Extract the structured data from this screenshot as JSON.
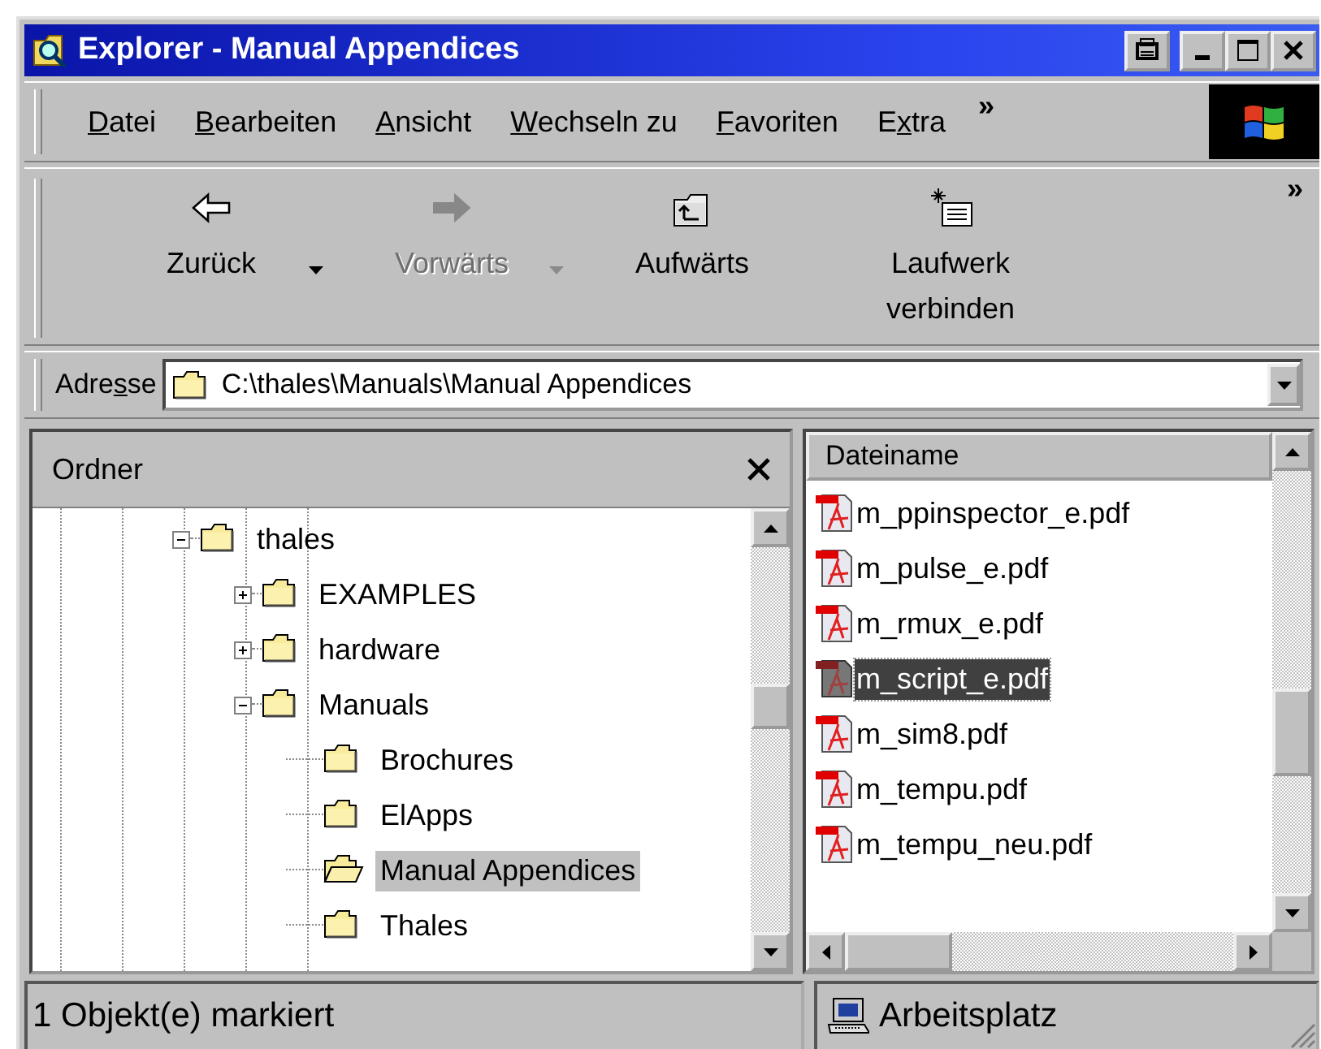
{
  "window": {
    "title": "Explorer - Manual Appendices"
  },
  "menu": {
    "items": [
      {
        "key": "D",
        "post": "atei"
      },
      {
        "key": "B",
        "post": "earbeiten"
      },
      {
        "key": "A",
        "post": "nsicht"
      },
      {
        "key": "W",
        "post": "echseln zu"
      },
      {
        "key": "F",
        "post": "avoriten"
      },
      {
        "pre": "E",
        "key": "x",
        "post": "tra"
      }
    ],
    "more": "»"
  },
  "toolbar": {
    "buttons": [
      {
        "kind": "back",
        "label": "Zurück",
        "disabled": false,
        "dropdown": true
      },
      {
        "kind": "forward",
        "label": "Vorwärts",
        "disabled": true,
        "dropdown": true
      },
      {
        "kind": "up",
        "label": "Aufwärts",
        "disabled": false,
        "dropdown": false
      },
      {
        "kind": "drive",
        "label": "Laufwerk verbinden",
        "disabled": false,
        "dropdown": false
      }
    ],
    "more": "»"
  },
  "address": {
    "label": {
      "pre": "Adre",
      "key": "s",
      "post": "se"
    },
    "value": "C:\\thales\\Manuals\\Manual Appendices"
  },
  "folders": {
    "title": "Ordner",
    "tree": [
      {
        "name": "thales",
        "expanded": true,
        "selected": false,
        "children": [
          {
            "name": "EXAMPLES",
            "expanded": false,
            "selected": false
          },
          {
            "name": "hardware",
            "expanded": false,
            "selected": false
          },
          {
            "name": "Manuals",
            "expanded": true,
            "selected": false,
            "children": [
              {
                "name": "Brochures",
                "selected": false
              },
              {
                "name": "ElApps",
                "selected": false
              },
              {
                "name": "Manual Appendices",
                "selected": true
              },
              {
                "name": "Thales",
                "selected": false
              }
            ]
          }
        ]
      }
    ]
  },
  "files": {
    "column": "Dateiname",
    "rows": [
      {
        "name": "m_ppinspector_e.pdf",
        "selected": false
      },
      {
        "name": "m_pulse_e.pdf",
        "selected": false
      },
      {
        "name": "m_rmux_e.pdf",
        "selected": false
      },
      {
        "name": "m_script_e.pdf",
        "selected": true
      },
      {
        "name": "m_sim8.pdf",
        "selected": false
      },
      {
        "name": "m_tempu.pdf",
        "selected": false
      },
      {
        "name": "m_tempu_neu.pdf",
        "selected": false
      }
    ]
  },
  "status_bar": {
    "message": "1 Objekt(e) markiert",
    "zone": "Arbeitsplatz"
  }
}
